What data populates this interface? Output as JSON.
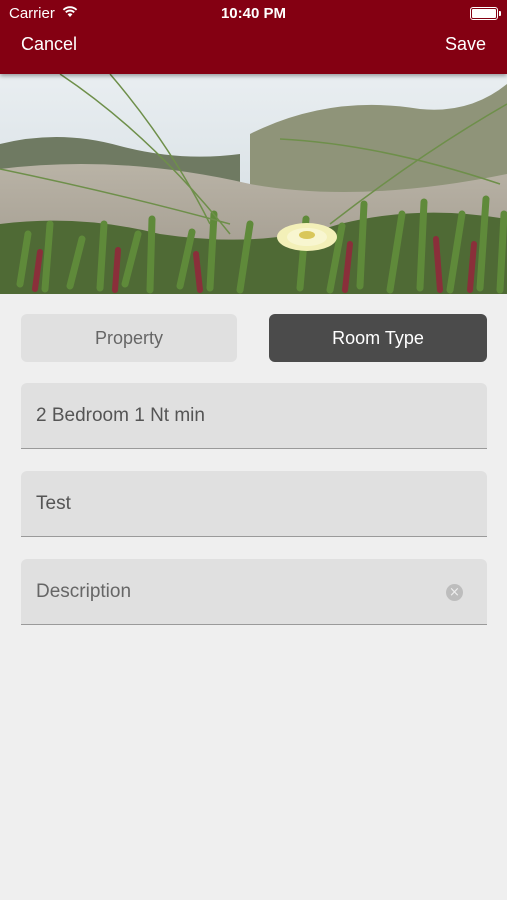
{
  "status_bar": {
    "carrier": "Carrier",
    "time": "10:40 PM"
  },
  "nav": {
    "cancel_label": "Cancel",
    "save_label": "Save"
  },
  "segments": {
    "property_label": "Property",
    "room_type_label": "Room Type",
    "selected": "Room Type"
  },
  "fields": {
    "room_name": "2 Bedroom 1 Nt min",
    "second": "Test",
    "description_placeholder": "Description"
  },
  "colors": {
    "nav_bar": "#840012",
    "selected_segment": "#4b4b4b",
    "field_background": "#e0e0e0",
    "page_background": "#efefef"
  },
  "icons": {
    "wifi": "wifi-icon",
    "battery": "battery-icon",
    "clear": "clear-icon"
  }
}
